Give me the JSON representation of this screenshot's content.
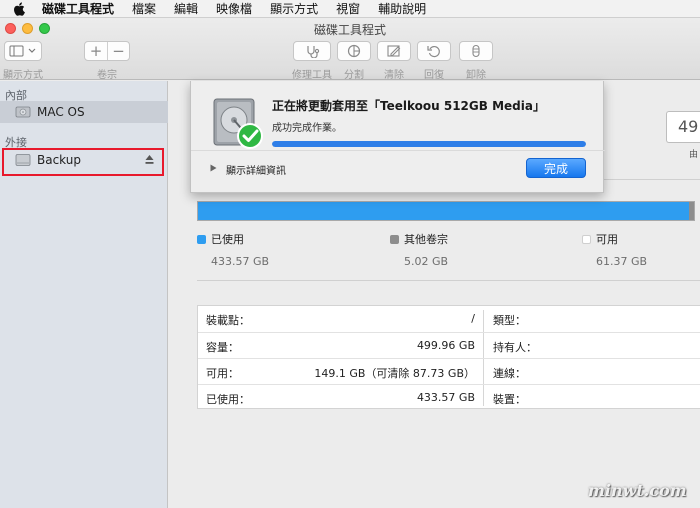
{
  "menubar": {
    "app_name": "磁碟工具程式",
    "items": [
      "檔案",
      "編輯",
      "映像檔",
      "顯示方式",
      "視窗",
      "輔助說明"
    ]
  },
  "window": {
    "title": "磁碟工具程式"
  },
  "toolbar": {
    "view_label": "顯示方式",
    "volume_label": "卷宗",
    "add_glyph": "+",
    "remove_glyph": "−",
    "first_aid_label": "修理工具",
    "partition_label": "分割",
    "erase_label": "清除",
    "restore_label": "回復",
    "unmount_label": "卸除"
  },
  "sidebar": {
    "internal_title": "內部",
    "internal_items": [
      {
        "label": "MAC OS"
      }
    ],
    "external_title": "外接",
    "external_items": [
      {
        "label": "Backup"
      }
    ]
  },
  "sheet": {
    "title": "正在將更動套用至「Teelkoou 512GB Media」",
    "subtitle": "成功完成作業。",
    "progress": 1.0,
    "details_label": "顯示詳細資訊",
    "done_label": "完成"
  },
  "main": {
    "capacity_value": "49",
    "capacity_unit": "由",
    "legend": [
      {
        "name": "已使用",
        "size": "433.57 GB",
        "color": "#2e9df0"
      },
      {
        "name": "其他卷宗",
        "size": "5.02 GB",
        "color": "#8d8d8d"
      },
      {
        "name": "可用",
        "size": "61.37 GB",
        "color": "#ffffff"
      }
    ],
    "info_rows": [
      {
        "key": "裝載點：",
        "value": "/",
        "key2": "類型："
      },
      {
        "key": "容量：",
        "value": "499.96 GB",
        "key2": "持有人："
      },
      {
        "key": "可用：",
        "value": "149.1 GB（可清除 87.73 GB）",
        "key2": "連線："
      },
      {
        "key": "已使用：",
        "value": "433.57 GB",
        "key2": "裝置："
      }
    ]
  },
  "watermark": "minwt.com",
  "colors": {
    "accent": "#2e7ee8",
    "highlight": "#e8192c",
    "check": "#2fb843"
  }
}
